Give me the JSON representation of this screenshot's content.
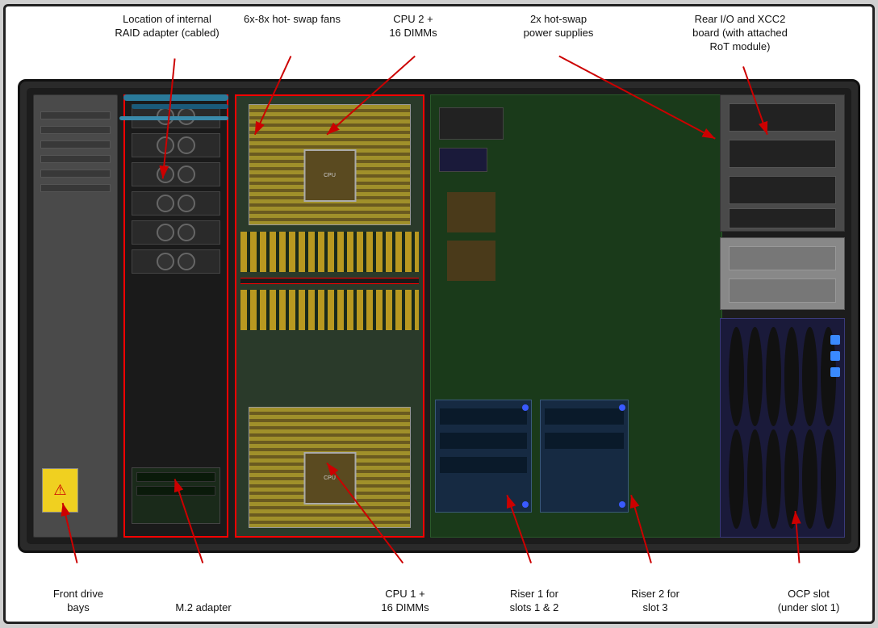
{
  "labels": {
    "location_of_internal_raid": "Location of\ninternal RAID\nadapter (cabled)",
    "fans": "6x-8x hot-\nswap fans",
    "cpu2_dimms": "CPU 2 +\n16 DIMMs",
    "power_supplies": "2x hot-swap\npower supplies",
    "rear_io": "Rear I/O and XCC2\nboard (with attached\nRoT module)",
    "front_drive_bays": "Front drive\nbays",
    "m2_adapter": "M.2 adapter",
    "cpu1_dimms": "CPU 1 +\n16 DIMMs",
    "riser1": "Riser 1 for\nslots 1 & 2",
    "riser2": "Riser 2 for\nslot 3",
    "ocp_slot": "OCP slot\n(under slot 1)"
  },
  "colors": {
    "arrow": "#cc0000",
    "border": "#222222",
    "background": "#ffffff"
  }
}
